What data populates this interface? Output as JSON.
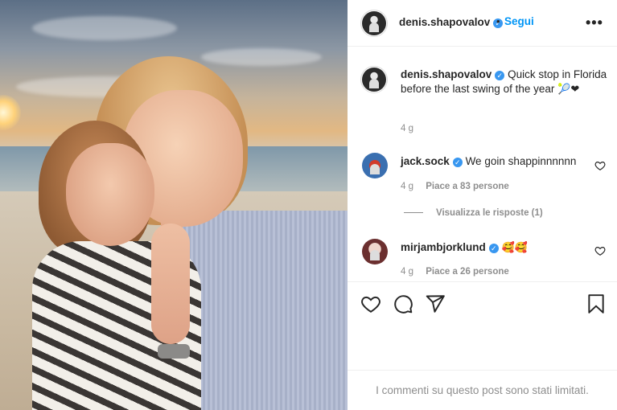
{
  "post": {
    "author": "denis.shapovalov",
    "follow_label": "Segui",
    "dot": "•",
    "more_label": "•••",
    "caption": "Quick stop in Florida before the last swing of the year",
    "caption_emojis": "🎾❤",
    "caption_time": "4 g"
  },
  "comments": [
    {
      "username": "jack.sock",
      "text": "We goin shappinnnnnn",
      "time": "4 g",
      "likes": "Piace a 83 persone",
      "replies": "Visualizza le risposte (1)"
    },
    {
      "username": "mirjambjorklund",
      "text": "🥰🥰",
      "time": "4 g",
      "likes": "Piace a 26 persone"
    }
  ],
  "footer": {
    "notice": "I commenti su questo post sono stati limitati."
  },
  "colors": {
    "accent": "#0095f6",
    "verified": "#3897f0",
    "muted": "#8e8e8e",
    "heart": "#ed4956"
  },
  "icons": {
    "verified": "verified-badge-icon",
    "like": "heart-icon",
    "comment": "comment-icon",
    "share": "paper-plane-icon",
    "save": "bookmark-icon"
  }
}
